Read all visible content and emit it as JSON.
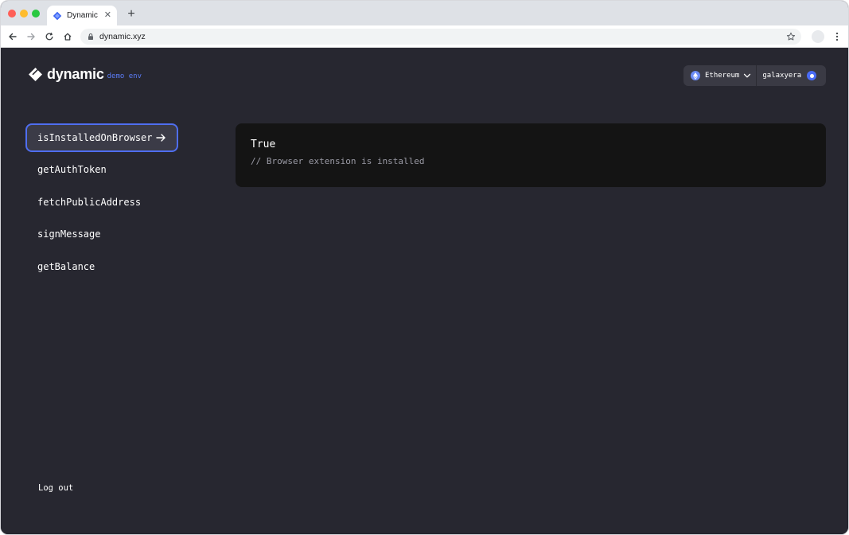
{
  "browser": {
    "tab": {
      "title": "Dynamic",
      "close_label": "✕"
    },
    "new_tab_label": "+",
    "url": "dynamic.xyz",
    "icons": [
      "back-icon",
      "forward-icon",
      "reload-icon",
      "home-icon",
      "lock-icon",
      "star-icon",
      "more-icon"
    ]
  },
  "brand": {
    "name": "dynamic",
    "env": "demo env",
    "color": "#5b7cf6"
  },
  "wallet": {
    "network": "Ethereum",
    "account": "galaxyera"
  },
  "sidebar": {
    "items": [
      {
        "label": "isInstalledOnBrowser",
        "active": true
      },
      {
        "label": "getAuthToken",
        "active": false
      },
      {
        "label": "fetchPublicAddress",
        "active": false
      },
      {
        "label": "signMessage",
        "active": false
      },
      {
        "label": "getBalance",
        "active": false
      }
    ],
    "logout_label": "Log out"
  },
  "result": {
    "value": "True",
    "comment": "// Browser extension is installed"
  },
  "colors": {
    "background": "#272730",
    "panel": "#141414",
    "accent": "#4f6ef0",
    "active_item": "#3b3b47"
  }
}
